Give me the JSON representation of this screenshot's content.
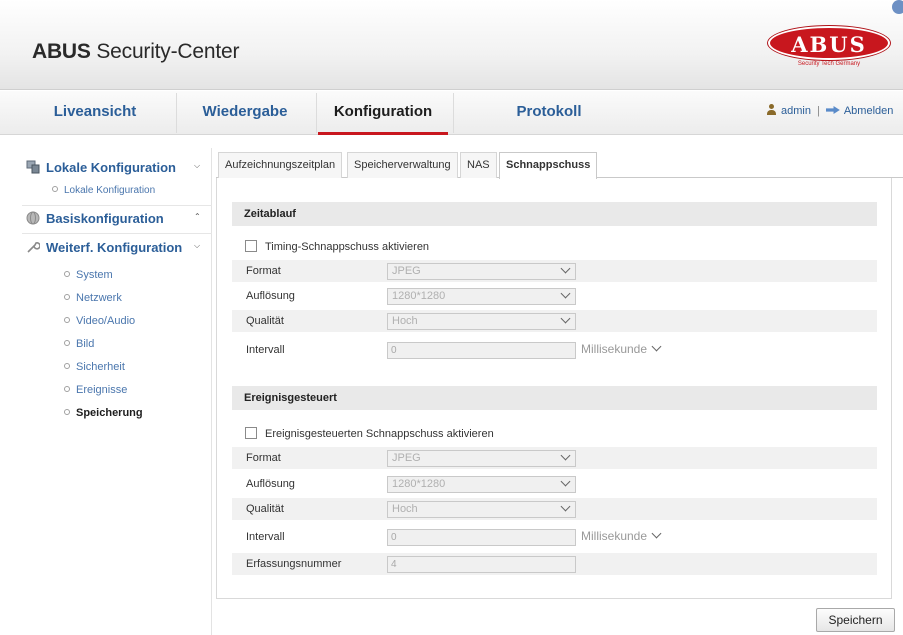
{
  "header": {
    "title_bold": "ABUS",
    "title_rest": " Security-Center",
    "logo_text": "ABUS",
    "logo_tagline": "Security Tech Germany"
  },
  "nav": {
    "items": [
      {
        "label": "Liveansicht"
      },
      {
        "label": "Wiedergabe"
      },
      {
        "label": "Konfiguration"
      },
      {
        "label": "Protokoll"
      }
    ],
    "active": "Konfiguration",
    "user": "admin",
    "separator": "|",
    "logout": "Abmelden"
  },
  "sidebar": {
    "groups": [
      {
        "label": "Lokale Konfiguration",
        "icon": "computer-icon",
        "expanded": true
      },
      {
        "label": "Basiskonfiguration",
        "icon": "globe-icon",
        "expanded": false
      },
      {
        "label": "Weiterf. Konfiguration",
        "icon": "wrench-icon",
        "expanded": true
      }
    ],
    "local_sub": "Lokale Konfiguration",
    "items": [
      "System",
      "Netzwerk",
      "Video/Audio",
      "Bild",
      "Sicherheit",
      "Ereignisse",
      "Speicherung"
    ],
    "active_item": "Speicherung"
  },
  "tabs": {
    "items": [
      "Aufzeichnungszeitplan",
      "Speicherverwaltung",
      "NAS",
      "Schnappschuss"
    ],
    "active": "Schnappschuss"
  },
  "timing": {
    "title": "Zeitablauf",
    "checkbox_label": "Timing-Schnappschuss aktivieren",
    "checked": false,
    "format_label": "Format",
    "format_value": "JPEG",
    "resolution_label": "Auflösung",
    "resolution_value": "1280*1280",
    "quality_label": "Qualität",
    "quality_value": "Hoch",
    "interval_label": "Intervall",
    "interval_value": "0",
    "interval_unit": "Millisekunde"
  },
  "event": {
    "title": "Ereignisgesteuert",
    "checkbox_label": "Ereignisgesteuerten Schnappschuss aktivieren",
    "checked": false,
    "format_label": "Format",
    "format_value": "JPEG",
    "resolution_label": "Auflösung",
    "resolution_value": "1280*1280",
    "quality_label": "Qualität",
    "quality_value": "Hoch",
    "interval_label": "Intervall",
    "interval_value": "0",
    "interval_unit": "Millisekunde",
    "capture_label": "Erfassungsnummer",
    "capture_value": "4"
  },
  "actions": {
    "save": "Speichern"
  },
  "colors": {
    "brand_red": "#c8171e",
    "link_blue": "#2b5e98"
  }
}
